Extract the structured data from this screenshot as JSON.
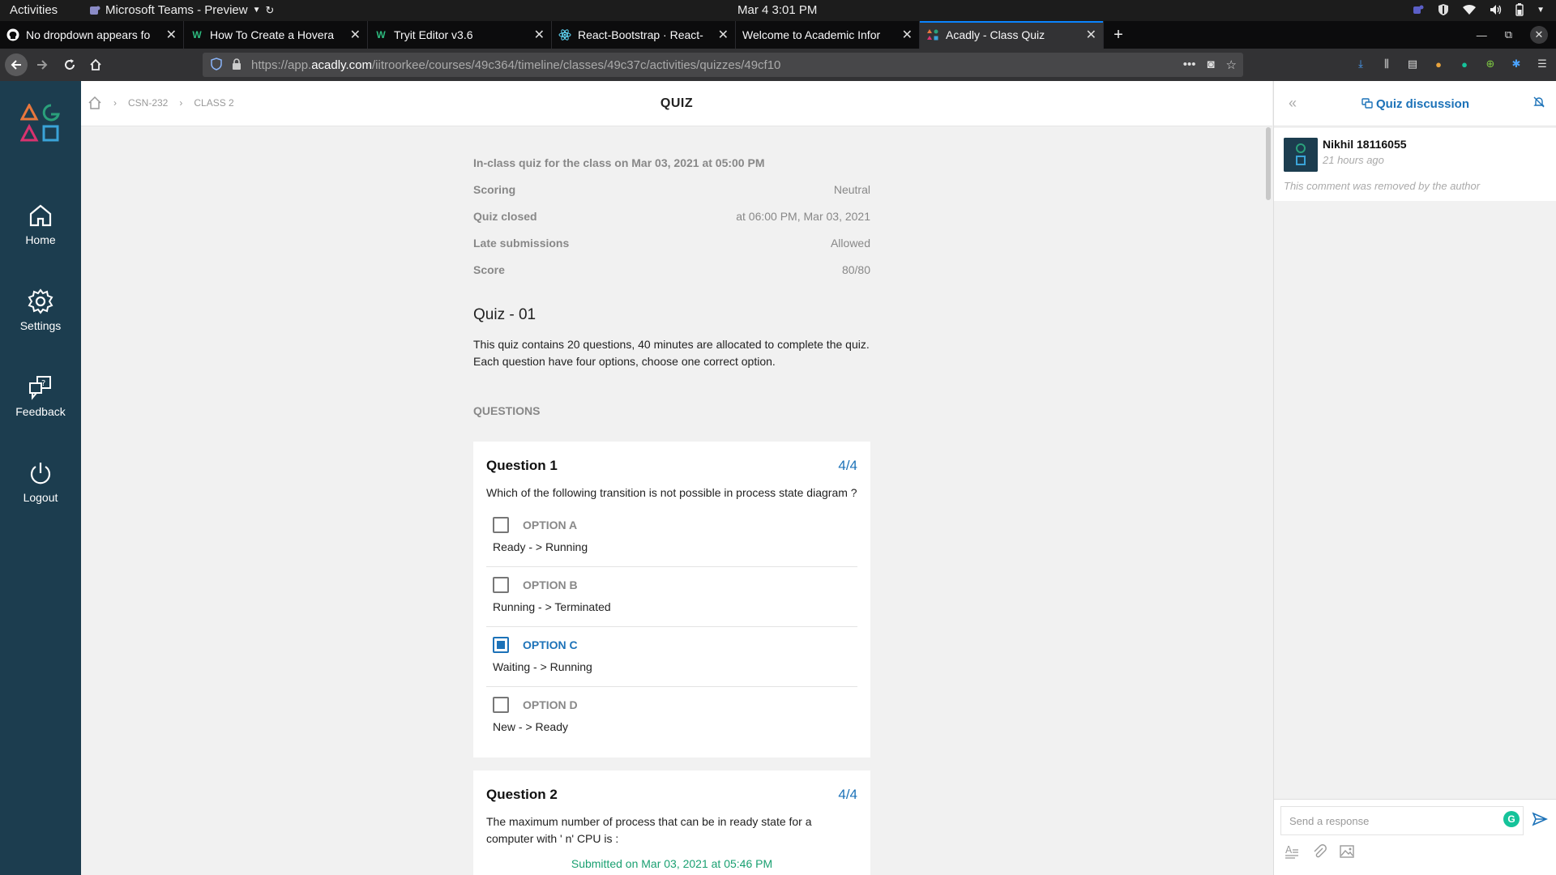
{
  "system": {
    "activities": "Activities",
    "app_name": "Microsoft Teams - Preview",
    "clock": "Mar 4  3:01 PM"
  },
  "tabs": [
    {
      "label": "No dropdown appears fo",
      "icon": "github-icon"
    },
    {
      "label": "How To Create a Hovera",
      "icon": "w3schools-icon"
    },
    {
      "label": "Tryit Editor v3.6",
      "icon": "w3schools-icon"
    },
    {
      "label": "React-Bootstrap · React-",
      "icon": "react-icon"
    },
    {
      "label": "Welcome to Academic Infor",
      "icon": ""
    },
    {
      "label": "Acadly - Class Quiz",
      "icon": "acadly-icon",
      "active": true
    }
  ],
  "browser": {
    "url_prefix": "https://app.",
    "url_domain": "acadly.com",
    "url_path": "/iitroorkee/courses/49c364/timeline/classes/49c37c/activities/quizzes/49cf10"
  },
  "sidebar": {
    "items": [
      {
        "label": "Home",
        "icon": "home-icon"
      },
      {
        "label": "Settings",
        "icon": "gear-icon"
      },
      {
        "label": "Feedback",
        "icon": "feedback-icon"
      },
      {
        "label": "Logout",
        "icon": "power-icon"
      }
    ]
  },
  "header": {
    "breadcrumb": [
      "CSN-232",
      "CLASS 2"
    ],
    "title": "QUIZ"
  },
  "quiz": {
    "intro": "In-class quiz for the class on Mar 03, 2021 at 05:00 PM",
    "info": [
      {
        "label": "Scoring",
        "value": "Neutral"
      },
      {
        "label": "Quiz closed",
        "value": "at 06:00 PM, Mar 03, 2021"
      },
      {
        "label": "Late submissions",
        "value": "Allowed"
      },
      {
        "label": "Score",
        "value": "80/80"
      }
    ],
    "name": "Quiz - 01",
    "description_line1": "This quiz contains 20 questions, 40 minutes are allocated to complete the quiz.",
    "description_line2": "Each question have four options, choose one correct option.",
    "questions_heading": "QUESTIONS",
    "questions": [
      {
        "title": "Question 1",
        "score": "4/4",
        "text": "Which of the following transition is not possible in process state diagram ?",
        "options": [
          {
            "label": "OPTION A",
            "text": "Ready - > Running",
            "selected": false
          },
          {
            "label": "OPTION B",
            "text": "Running - > Terminated",
            "selected": false
          },
          {
            "label": "OPTION C",
            "text": "Waiting - > Running",
            "selected": true
          },
          {
            "label": "OPTION D",
            "text": "New - > Ready",
            "selected": false
          }
        ]
      },
      {
        "title": "Question 2",
        "score": "4/4",
        "text": "The maximum number of process that can be in ready state for a computer with ' n'  CPU is :"
      }
    ],
    "submitted": "Submitted on Mar 03, 2021 at 05:46 PM"
  },
  "discussion": {
    "title": "Quiz discussion",
    "comment": {
      "author": "Nikhil 18116055",
      "time": "21 hours ago",
      "text": "This comment was removed by the author"
    },
    "reply_placeholder": "Send a response"
  },
  "colors": {
    "accent": "#1c72b8",
    "sidebar": "#1c3d4f",
    "submitted": "#1aa071"
  }
}
